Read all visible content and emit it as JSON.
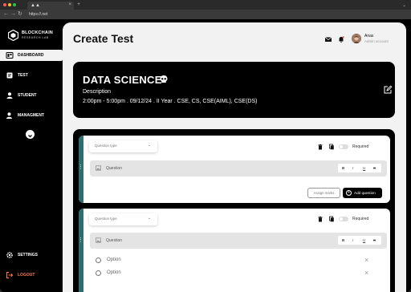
{
  "browser": {
    "tab_title": "",
    "url": "https://.net"
  },
  "sidebar": {
    "brand_title": "BLOCKCHAIN",
    "brand_subtitle": "RESEARCH LAB",
    "items": [
      {
        "label": "DASHBOARD",
        "icon": "dashboard-icon",
        "active": true
      },
      {
        "label": "TEST",
        "icon": "test-icon",
        "active": false
      },
      {
        "label": "STUDENT",
        "icon": "student-icon",
        "active": false
      },
      {
        "label": "MANAGMENT",
        "icon": "management-icon",
        "active": false
      }
    ],
    "bottom_items": [
      {
        "label": "SETTINGS",
        "icon": "gear-icon"
      },
      {
        "label": "LOGOUT",
        "icon": "logout-icon",
        "color": "#ff7a45"
      }
    ]
  },
  "header": {
    "title": "Create Test",
    "user_name": "Anas",
    "user_role": "Admin account"
  },
  "test": {
    "title": "DATA SCIENCE",
    "description": "Description",
    "meta": "2:00pm - 5:00pm . 09/12/24 . II Year . CSE, CS, CSE(AIML), CSE(DS)"
  },
  "questions": [
    {
      "type_placeholder": "Question type",
      "question_placeholder": "Question",
      "required_label": "Required",
      "formatting": [
        "B",
        "I",
        "U",
        "S"
      ],
      "assign_marks_label": "Assign marks",
      "add_question_label": "Add question",
      "options": []
    },
    {
      "type_placeholder": "Question type",
      "question_placeholder": "Question",
      "required_label": "Required",
      "formatting": [
        "B",
        "I",
        "U",
        "S"
      ],
      "options": [
        "Option",
        "Option"
      ]
    }
  ],
  "colors": {
    "accent_stripe": "#2f6e6e",
    "logout": "#ff7a45",
    "background": "#f2f2f2"
  }
}
